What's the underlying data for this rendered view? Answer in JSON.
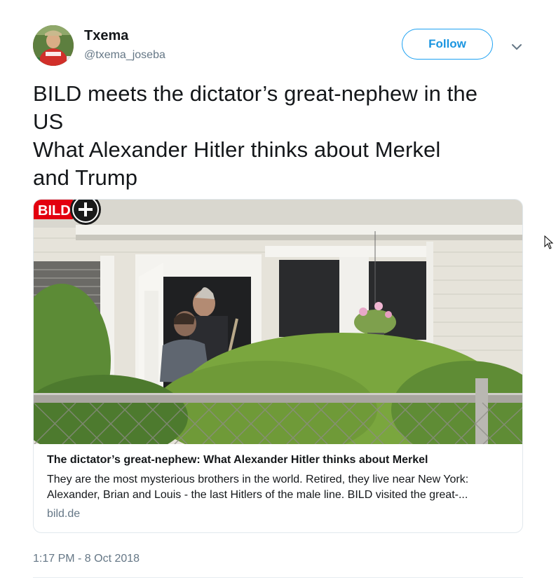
{
  "user": {
    "display_name": "Txema",
    "handle": "@txema_joseba",
    "follow_label": "Follow"
  },
  "tweet": {
    "lines": [
      "BILD meets the dictator’s great-nephew in the",
      "US",
      "What Alexander Hitler thinks about Merkel",
      "and Trump"
    ],
    "timestamp": "1:17 PM - 8 Oct 2018"
  },
  "card": {
    "badge_text": "BILD",
    "title": "The dictator’s great-nephew: What Alexander Hitler thinks about Merkel",
    "description_lines": [
      "They are the most mysterious brothers in the world. Retired, they live near New York:",
      "Alexander, Brian and Louis - the last Hitlers of the male line. BILD visited the great-..."
    ],
    "domain": "bild.de"
  },
  "colors": {
    "accent": "#1da1f2",
    "text_primary": "#14171a",
    "text_secondary": "#657786",
    "border": "#e1e8ed"
  },
  "icons": {
    "caret": "chevron-down-icon",
    "badge_plus": "plus-icon"
  }
}
